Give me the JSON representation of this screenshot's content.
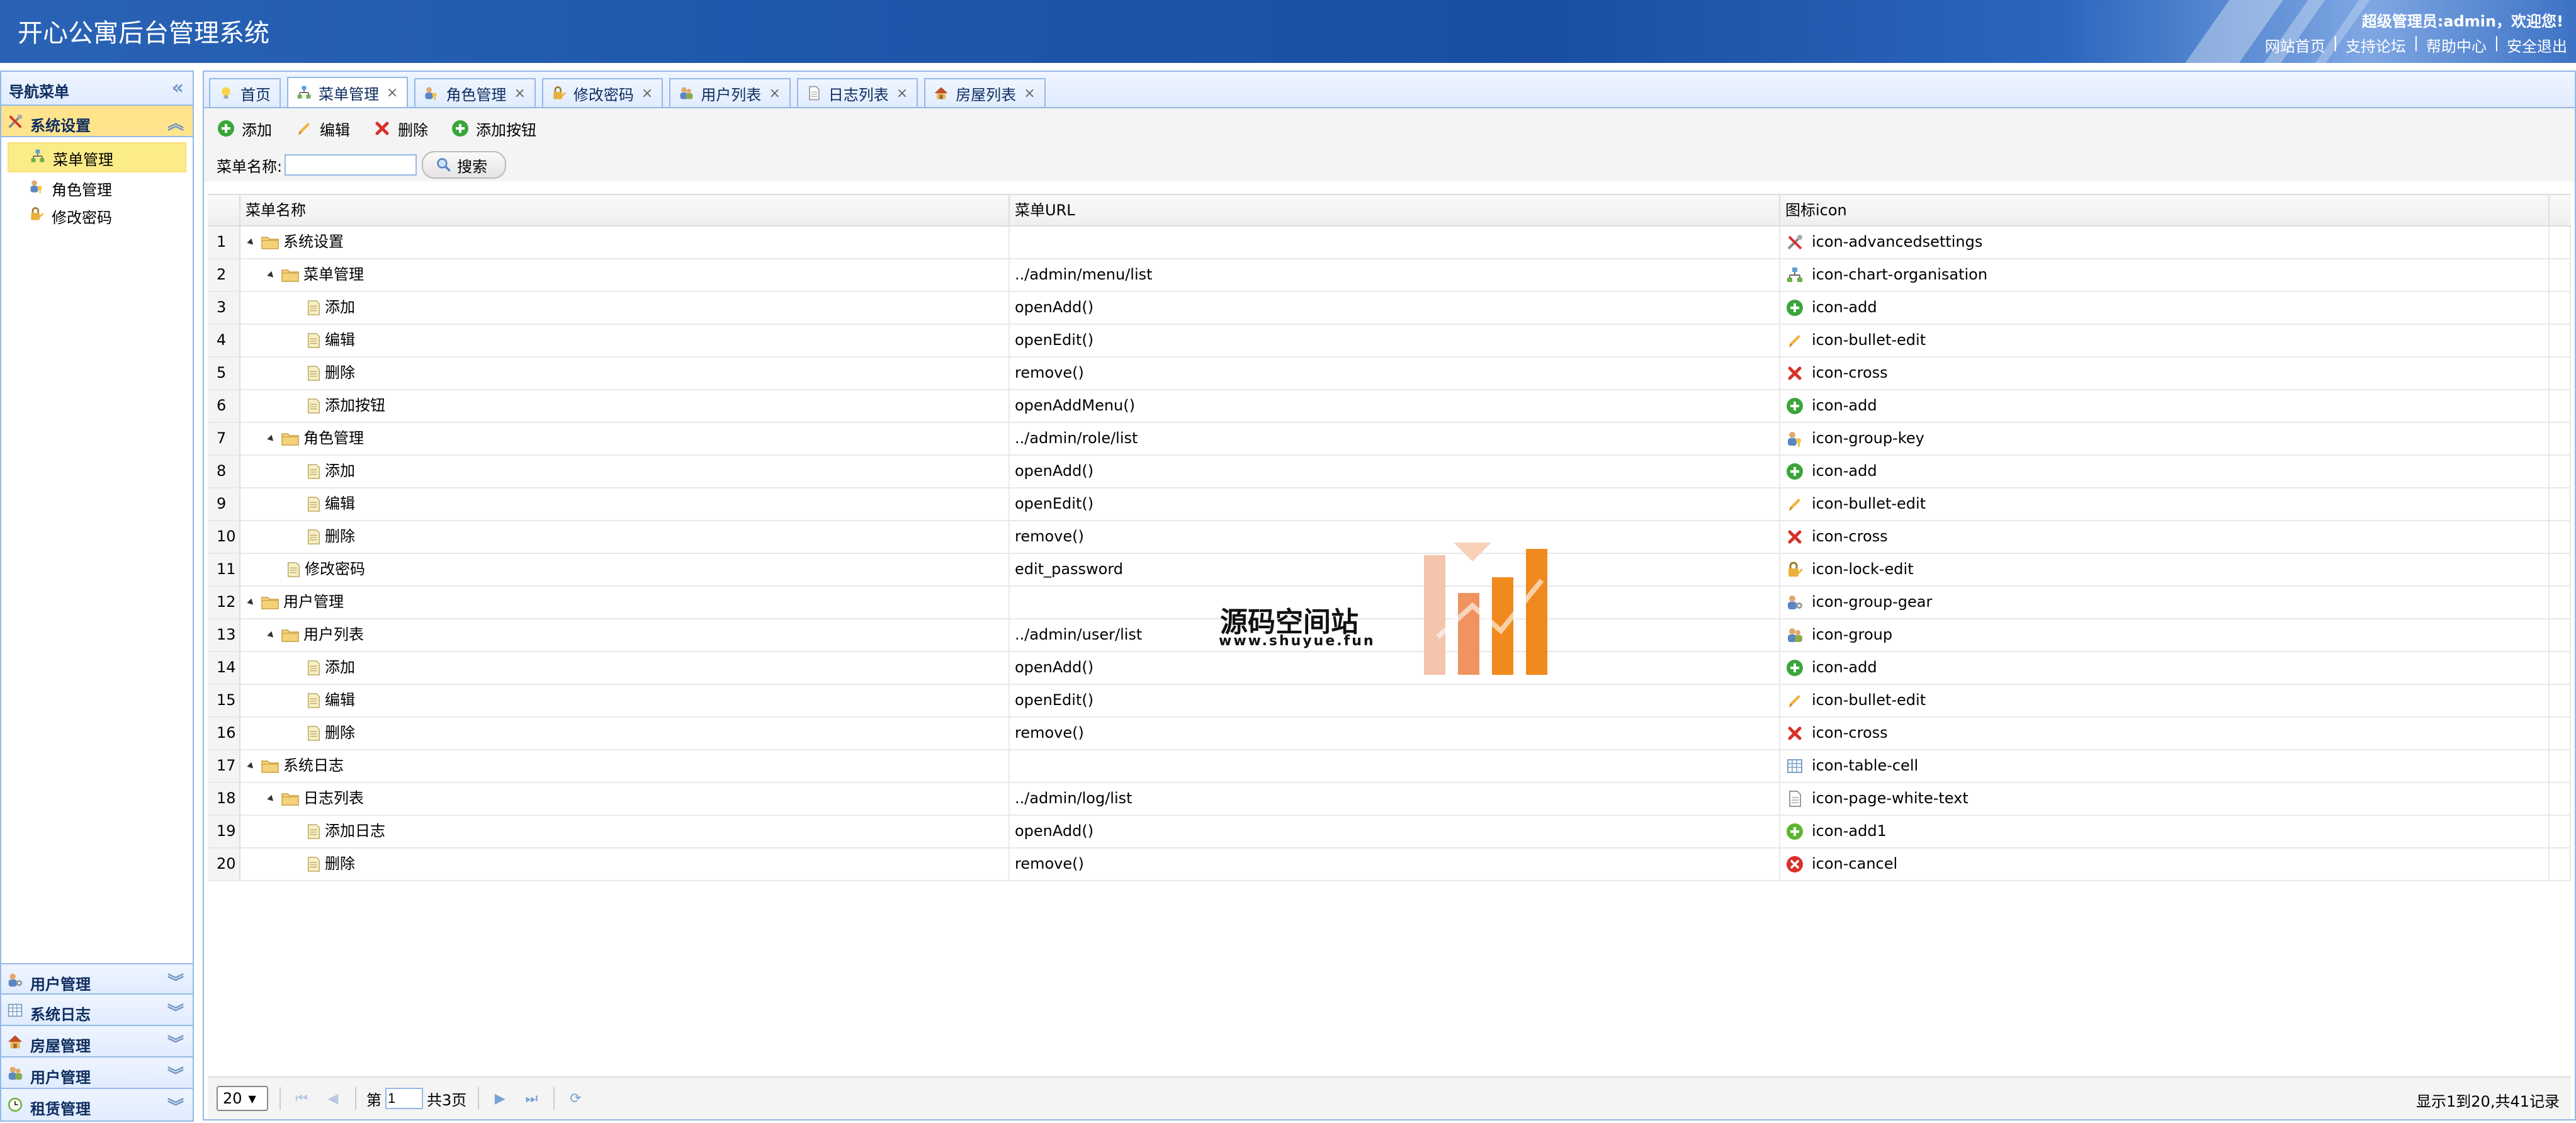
{
  "header": {
    "title": "开心公寓后台管理系统",
    "welcome": "超级管理员:admin，欢迎您!",
    "links": [
      "网站首页",
      "支持论坛",
      "帮助中心",
      "安全退出"
    ],
    "separator": "|"
  },
  "nav": {
    "title": "导航菜单",
    "collapse_icon": "double-chevron-left-icon",
    "open_group": {
      "label": "系统设置",
      "icon": "tools-icon"
    },
    "items": [
      {
        "label": "菜单管理",
        "icon": "org-chart-icon",
        "selected": true
      },
      {
        "label": "角色管理",
        "icon": "group-key-icon",
        "selected": false
      },
      {
        "label": "修改密码",
        "icon": "lock-edit-icon",
        "selected": false
      }
    ],
    "groups": [
      {
        "label": "用户管理",
        "icon": "group-gear-icon"
      },
      {
        "label": "系统日志",
        "icon": "table-cell-icon"
      },
      {
        "label": "房屋管理",
        "icon": "house-icon"
      },
      {
        "label": "用户管理",
        "icon": "group-icon"
      },
      {
        "label": "租赁管理",
        "icon": "clock-icon"
      }
    ]
  },
  "tabs": [
    {
      "label": "首页",
      "icon": "lightbulb-icon",
      "closable": false,
      "active": false
    },
    {
      "label": "菜单管理",
      "icon": "org-chart-icon",
      "closable": true,
      "active": true
    },
    {
      "label": "角色管理",
      "icon": "group-key-icon",
      "closable": true,
      "active": false
    },
    {
      "label": "修改密码",
      "icon": "lock-edit-icon",
      "closable": true,
      "active": false
    },
    {
      "label": "用户列表",
      "icon": "group-icon",
      "closable": true,
      "active": false
    },
    {
      "label": "日志列表",
      "icon": "page-icon",
      "closable": true,
      "active": false
    },
    {
      "label": "房屋列表",
      "icon": "house-icon",
      "closable": true,
      "active": false
    }
  ],
  "tab_close": "×",
  "toolbar": {
    "buttons": [
      {
        "label": "添加",
        "icon": "add-icon"
      },
      {
        "label": "编辑",
        "icon": "pencil-icon"
      },
      {
        "label": "删除",
        "icon": "cross-icon"
      },
      {
        "label": "添加按钮",
        "icon": "add-icon"
      }
    ]
  },
  "search": {
    "label": "菜单名称:",
    "value": "",
    "button": "搜索"
  },
  "grid": {
    "columns": [
      "菜单名称",
      "菜单URL",
      "图标icon"
    ],
    "rows": [
      {
        "num": "1",
        "level": 0,
        "folder": true,
        "name": "系统设置",
        "url": "",
        "icon_name": "icon-advancedsettings",
        "icon": "tools-icon"
      },
      {
        "num": "2",
        "level": 1,
        "folder": true,
        "name": "菜单管理",
        "url": "../admin/menu/list",
        "icon_name": "icon-chart-organisation",
        "icon": "org-chart-icon"
      },
      {
        "num": "3",
        "level": 2,
        "folder": false,
        "name": "添加",
        "url": "openAdd()",
        "icon_name": "icon-add",
        "icon": "add-icon"
      },
      {
        "num": "4",
        "level": 2,
        "folder": false,
        "name": "编辑",
        "url": "openEdit()",
        "icon_name": "icon-bullet-edit",
        "icon": "pencil-icon"
      },
      {
        "num": "5",
        "level": 2,
        "folder": false,
        "name": "删除",
        "url": "remove()",
        "icon_name": "icon-cross",
        "icon": "cross-icon"
      },
      {
        "num": "6",
        "level": 2,
        "folder": false,
        "name": "添加按钮",
        "url": "openAddMenu()",
        "icon_name": "icon-add",
        "icon": "add-icon"
      },
      {
        "num": "7",
        "level": 1,
        "folder": true,
        "name": "角色管理",
        "url": "../admin/role/list",
        "icon_name": "icon-group-key",
        "icon": "group-key-icon"
      },
      {
        "num": "8",
        "level": 2,
        "folder": false,
        "name": "添加",
        "url": "openAdd()",
        "icon_name": "icon-add",
        "icon": "add-icon"
      },
      {
        "num": "9",
        "level": 2,
        "folder": false,
        "name": "编辑",
        "url": "openEdit()",
        "icon_name": "icon-bullet-edit",
        "icon": "pencil-icon"
      },
      {
        "num": "10",
        "level": 2,
        "folder": false,
        "name": "删除",
        "url": "remove()",
        "icon_name": "icon-cross",
        "icon": "cross-icon"
      },
      {
        "num": "11",
        "level": 1,
        "folder": false,
        "name": "修改密码",
        "url": "edit_password",
        "icon_name": "icon-lock-edit",
        "icon": "lock-edit-icon"
      },
      {
        "num": "12",
        "level": 0,
        "folder": true,
        "name": "用户管理",
        "url": "",
        "icon_name": "icon-group-gear",
        "icon": "group-gear-icon"
      },
      {
        "num": "13",
        "level": 1,
        "folder": true,
        "name": "用户列表",
        "url": "../admin/user/list",
        "icon_name": "icon-group",
        "icon": "group-icon"
      },
      {
        "num": "14",
        "level": 2,
        "folder": false,
        "name": "添加",
        "url": "openAdd()",
        "icon_name": "icon-add",
        "icon": "add-icon"
      },
      {
        "num": "15",
        "level": 2,
        "folder": false,
        "name": "编辑",
        "url": "openEdit()",
        "icon_name": "icon-bullet-edit",
        "icon": "pencil-icon"
      },
      {
        "num": "16",
        "level": 2,
        "folder": false,
        "name": "删除",
        "url": "remove()",
        "icon_name": "icon-cross",
        "icon": "cross-icon"
      },
      {
        "num": "17",
        "level": 0,
        "folder": true,
        "name": "系统日志",
        "url": "",
        "icon_name": "icon-table-cell",
        "icon": "table-cell-icon"
      },
      {
        "num": "18",
        "level": 1,
        "folder": true,
        "name": "日志列表",
        "url": "../admin/log/list",
        "icon_name": "icon-page-white-text",
        "icon": "page-icon"
      },
      {
        "num": "19",
        "level": 2,
        "folder": false,
        "name": "添加日志",
        "url": "openAdd()",
        "icon_name": "icon-add1",
        "icon": "add-circle-icon"
      },
      {
        "num": "20",
        "level": 2,
        "folder": false,
        "name": "删除",
        "url": "remove()",
        "icon_name": "icon-cancel",
        "icon": "cancel-icon"
      }
    ]
  },
  "pager": {
    "page_size": "20",
    "page_label": "第",
    "page_value": "1",
    "total_pages": "共3页",
    "display": "显示1到20,共41记录"
  },
  "watermark": {
    "title": "源码空间站",
    "url": "www.shuyue.fun"
  },
  "colors": {
    "header_blue": "#1e58ad",
    "panel_border": "#95b8e7",
    "selected_yellow": "#fbec88",
    "watermark_orange": "#f08a1e"
  }
}
